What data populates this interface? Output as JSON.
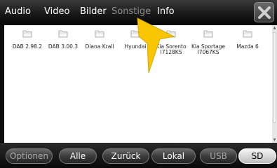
{
  "tabs": [
    {
      "label": "Audio",
      "active": true
    },
    {
      "label": "Video",
      "active": true
    },
    {
      "label": "Bilder",
      "active": true
    },
    {
      "label": "Sonstige",
      "active": false
    },
    {
      "label": "Info",
      "active": true
    }
  ],
  "files": [
    {
      "label": "DAB 2.98.2"
    },
    {
      "label": "DAB 3.00.3"
    },
    {
      "label": "Diana Krall"
    },
    {
      "label": "Hyundai"
    },
    {
      "label": "Kia Sorento\nI7128KS"
    },
    {
      "label": "Kia Sportage\nI7067KS"
    },
    {
      "label": "Mazda 6"
    }
  ],
  "bottom_buttons": [
    {
      "label": "Optionen"
    },
    {
      "label": "Alle"
    },
    {
      "label": "Zurück"
    },
    {
      "label": "Lokal"
    },
    {
      "label": "USB"
    },
    {
      "label": "SD"
    }
  ],
  "colors": {
    "arrow": "#f7c600",
    "background": "#0c0c0c",
    "list": "#ffffff"
  },
  "icons": {
    "close": "close-icon",
    "folder": "folder-icon",
    "pointer": "arrow-pointer-icon"
  }
}
